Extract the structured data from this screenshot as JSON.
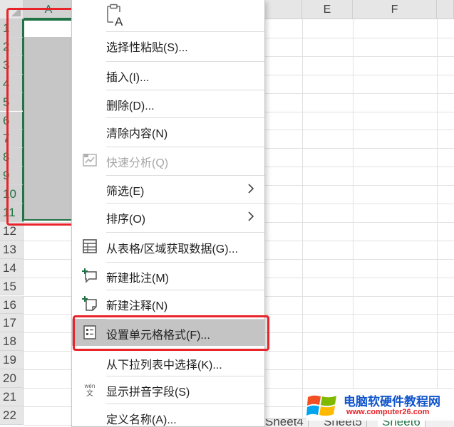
{
  "sheet": {
    "columns": [
      "A",
      "E",
      "F"
    ],
    "rows": [
      "1",
      "2",
      "3",
      "4",
      "5",
      "6",
      "7",
      "8",
      "9",
      "10",
      "11",
      "12",
      "13",
      "14",
      "15",
      "16",
      "17",
      "18",
      "19",
      "20",
      "21",
      "22"
    ],
    "selected_column": "A",
    "tabs": [
      "Sheet4",
      "Sheet5",
      "Sheet6"
    ],
    "active_tab": "Sheet6"
  },
  "menu": {
    "items": [
      {
        "label": "选择性粘贴(S)...",
        "icon": "none",
        "disabled": false,
        "submenu": false
      },
      {
        "label": "插入(I)...",
        "icon": "none",
        "disabled": false,
        "submenu": false
      },
      {
        "label": "删除(D)...",
        "icon": "none",
        "disabled": false,
        "submenu": false
      },
      {
        "label": "清除内容(N)",
        "icon": "none",
        "disabled": false,
        "submenu": false
      },
      {
        "label": "快速分析(Q)",
        "icon": "quick-analysis-icon",
        "disabled": true,
        "submenu": false
      },
      {
        "label": "筛选(E)",
        "icon": "none",
        "disabled": false,
        "submenu": true
      },
      {
        "label": "排序(O)",
        "icon": "none",
        "disabled": false,
        "submenu": true
      },
      {
        "label": "从表格/区域获取数据(G)...",
        "icon": "table-icon",
        "disabled": false,
        "submenu": false
      },
      {
        "label": "新建批注(M)",
        "icon": "new-comment-icon",
        "disabled": false,
        "submenu": false
      },
      {
        "label": "新建注释(N)",
        "icon": "new-note-icon",
        "disabled": false,
        "submenu": false
      },
      {
        "label": "设置单元格格式(F)...",
        "icon": "format-cells-icon",
        "disabled": false,
        "submenu": false,
        "highlighted": true
      },
      {
        "label": "从下拉列表中选择(K)...",
        "icon": "none",
        "disabled": false,
        "submenu": false
      },
      {
        "label": "显示拼音字段(S)",
        "icon": "phonetic-icon",
        "disabled": false,
        "submenu": false
      },
      {
        "label": "定义名称(A)...",
        "icon": "none",
        "disabled": false,
        "submenu": false
      }
    ],
    "phonetic_icon_text": {
      "top": "wén",
      "bottom": "文"
    },
    "paste_icon_letter": "A"
  },
  "watermark": {
    "title": "电脑软硬件教程网",
    "url": "www.computer26.com"
  },
  "colors": {
    "excel_green": "#217346",
    "annotation_red": "#e8242a",
    "menu_hover": "#c4c4c4",
    "header_bg": "#e6e6e6"
  }
}
